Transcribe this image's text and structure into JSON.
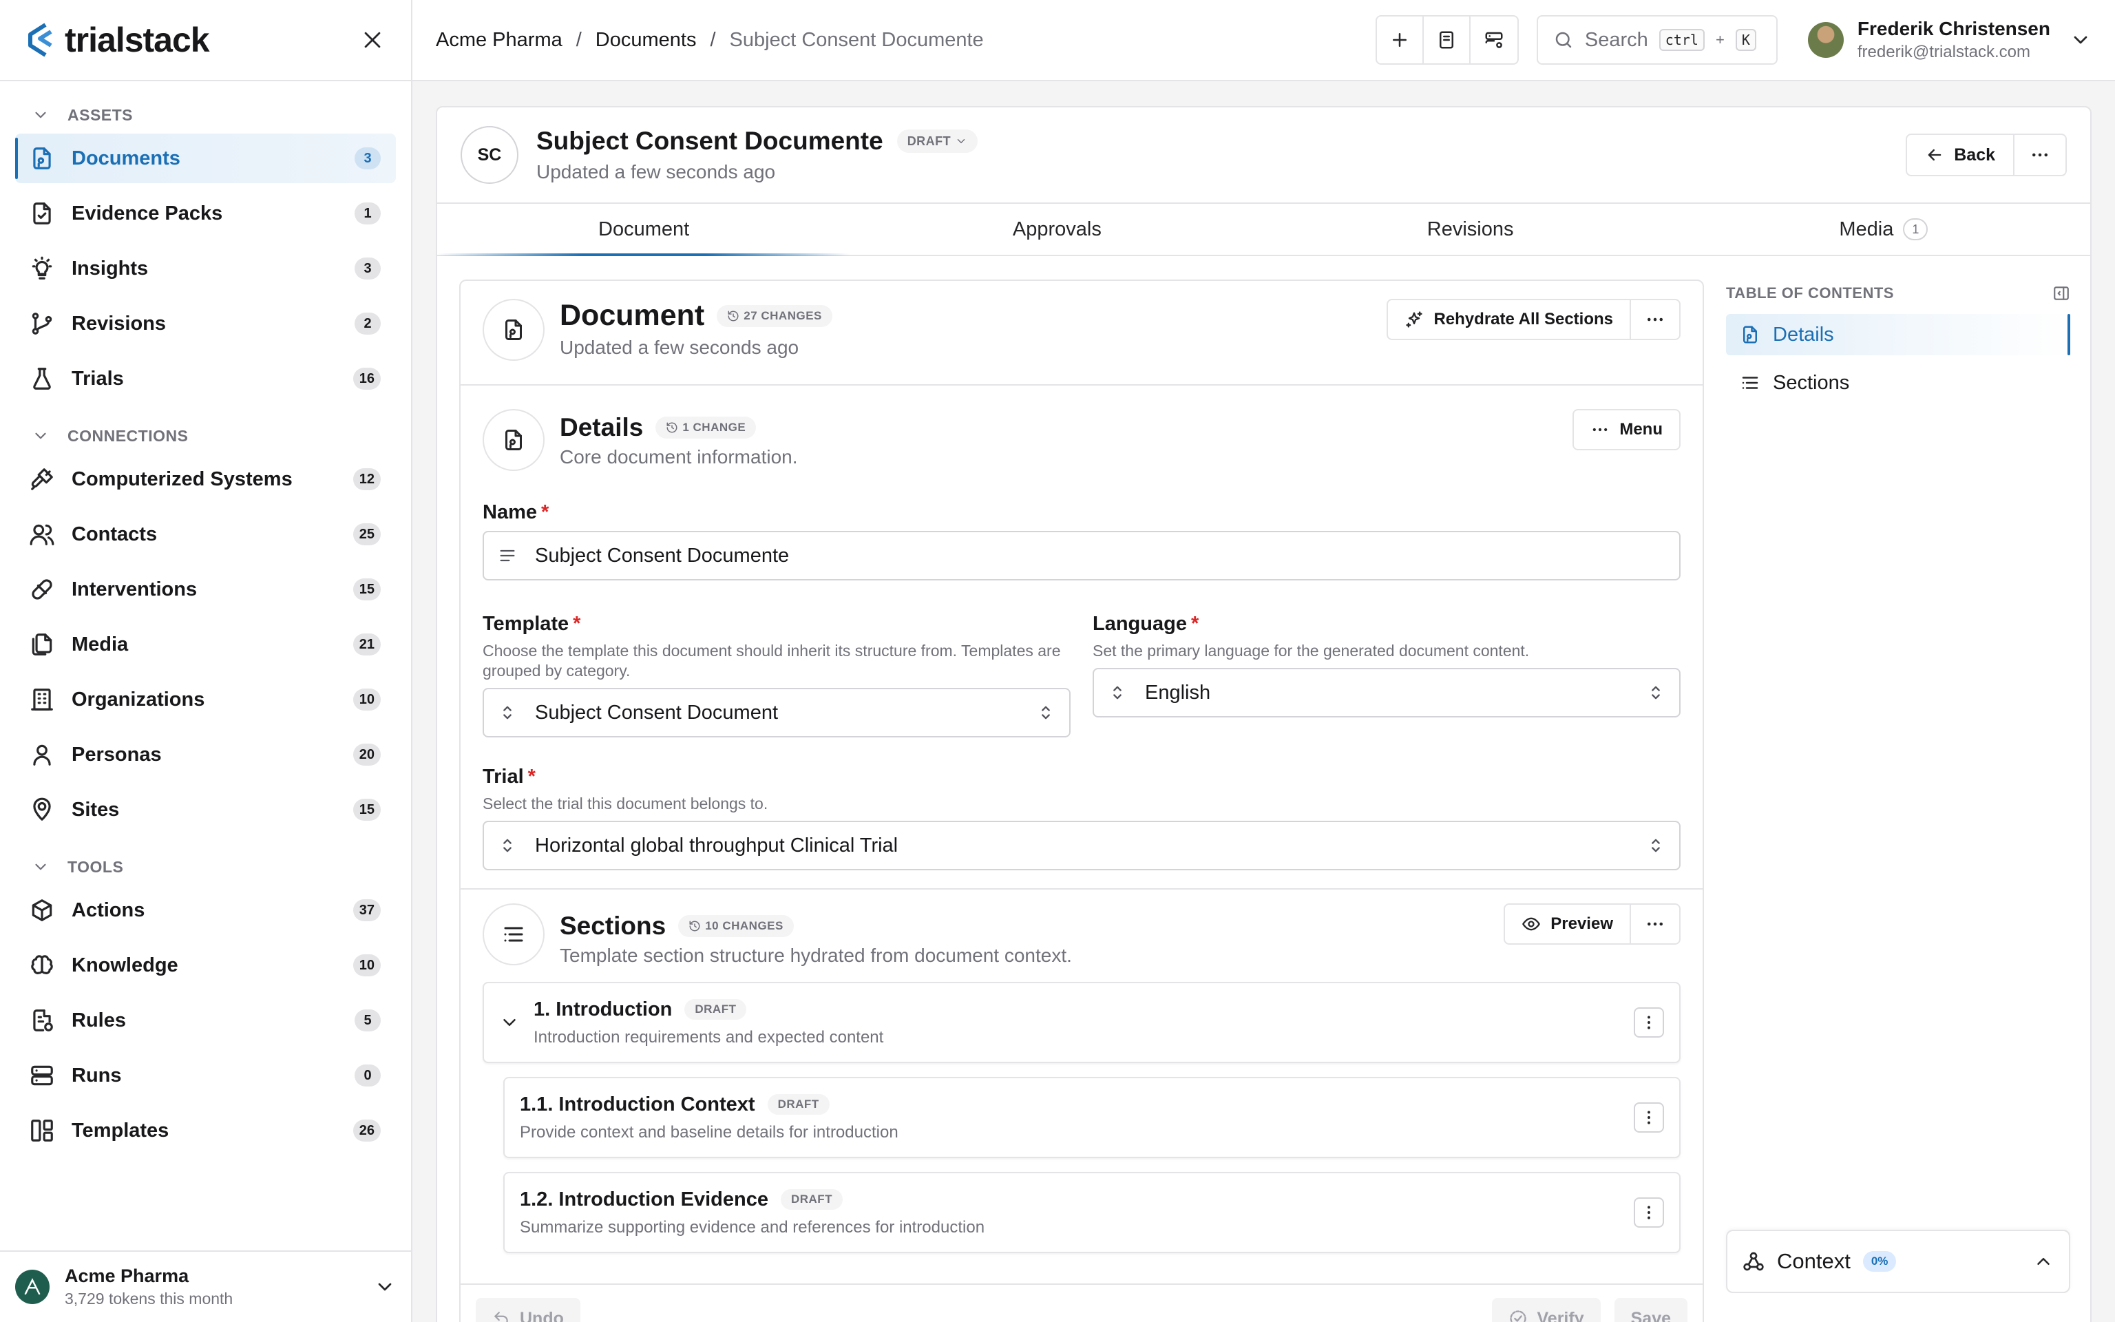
{
  "app": {
    "logo_text": "trialstack",
    "brand_color": "#1b6fb5"
  },
  "sidebar": {
    "groups": [
      {
        "title": "ASSETS",
        "items": [
          {
            "label": "Documents",
            "count": "3",
            "icon": "document-icon",
            "active": true
          },
          {
            "label": "Evidence Packs",
            "count": "1",
            "icon": "evidence-pack-icon"
          },
          {
            "label": "Insights",
            "count": "3",
            "icon": "lightbulb-icon"
          },
          {
            "label": "Revisions",
            "count": "2",
            "icon": "git-branch-icon"
          },
          {
            "label": "Trials",
            "count": "16",
            "icon": "flask-icon"
          }
        ]
      },
      {
        "title": "CONNECTIONS",
        "items": [
          {
            "label": "Computerized Systems",
            "count": "12",
            "icon": "plug-icon"
          },
          {
            "label": "Contacts",
            "count": "25",
            "icon": "users-icon"
          },
          {
            "label": "Interventions",
            "count": "15",
            "icon": "pill-icon"
          },
          {
            "label": "Media",
            "count": "21",
            "icon": "files-icon"
          },
          {
            "label": "Organizations",
            "count": "10",
            "icon": "building-icon"
          },
          {
            "label": "Personas",
            "count": "20",
            "icon": "user-icon"
          },
          {
            "label": "Sites",
            "count": "15",
            "icon": "map-pin-icon"
          }
        ]
      },
      {
        "title": "TOOLS",
        "items": [
          {
            "label": "Actions",
            "count": "37",
            "icon": "package-icon"
          },
          {
            "label": "Knowledge",
            "count": "10",
            "icon": "brain-icon"
          },
          {
            "label": "Rules",
            "count": "5",
            "icon": "file-rule-icon"
          },
          {
            "label": "Runs",
            "count": "0",
            "icon": "server-icon"
          },
          {
            "label": "Templates",
            "count": "26",
            "icon": "layout-icon"
          }
        ]
      }
    ],
    "footer": {
      "org_name": "Acme Pharma",
      "tokens": "3,729 tokens this month"
    }
  },
  "topbar": {
    "breadcrumbs": [
      "Acme Pharma",
      "Documents",
      "Subject Consent Documente"
    ],
    "search_placeholder": "Search",
    "search_kbd": "ctrl",
    "search_plus": "+",
    "search_key": "K",
    "user": {
      "name": "Frederik Christensen",
      "email": "frederik@trialstack.com"
    }
  },
  "doc": {
    "avatar": "SC",
    "title": "Subject Consent Documente",
    "status": "DRAFT",
    "updated": "Updated a few seconds ago",
    "back_label": "Back"
  },
  "tabs": [
    {
      "label": "Document",
      "active": true
    },
    {
      "label": "Approvals"
    },
    {
      "label": "Revisions"
    },
    {
      "label": "Media",
      "count": "1"
    }
  ],
  "document_section": {
    "title": "Document",
    "changes": "27 CHANGES",
    "updated": "Updated a few seconds ago",
    "rehydrate_label": "Rehydrate All Sections"
  },
  "details": {
    "title": "Details",
    "changes": "1 CHANGE",
    "subtitle": "Core document information.",
    "menu_label": "Menu",
    "name": {
      "label": "Name",
      "value": "Subject Consent Documente"
    },
    "template": {
      "label": "Template",
      "help": "Choose the template this document should inherit its structure from. Templates are grouped by category.",
      "value": "Subject Consent Document"
    },
    "language": {
      "label": "Language",
      "help": "Set the primary language for the generated document content.",
      "value": "English"
    },
    "trial": {
      "label": "Trial",
      "help": "Select the trial this document belongs to.",
      "value": "Horizontal global throughput Clinical Trial"
    }
  },
  "sections": {
    "title": "Sections",
    "changes": "10 CHANGES",
    "subtitle": "Template section structure hydrated from document context.",
    "preview_label": "Preview",
    "items": [
      {
        "title": "1. Introduction",
        "status": "DRAFT",
        "desc": "Introduction requirements and expected content"
      },
      {
        "title": "1.1. Introduction Context",
        "status": "DRAFT",
        "desc": "Provide context and baseline details for introduction"
      },
      {
        "title": "1.2. Introduction Evidence",
        "status": "DRAFT",
        "desc": "Summarize supporting evidence and references for introduction"
      }
    ]
  },
  "footer": {
    "undo": "Undo",
    "verify": "Verify",
    "save": "Save"
  },
  "toc": {
    "title": "TABLE OF CONTENTS",
    "items": [
      {
        "label": "Details",
        "active": true
      },
      {
        "label": "Sections"
      }
    ]
  },
  "context": {
    "label": "Context",
    "percent": "0%"
  }
}
